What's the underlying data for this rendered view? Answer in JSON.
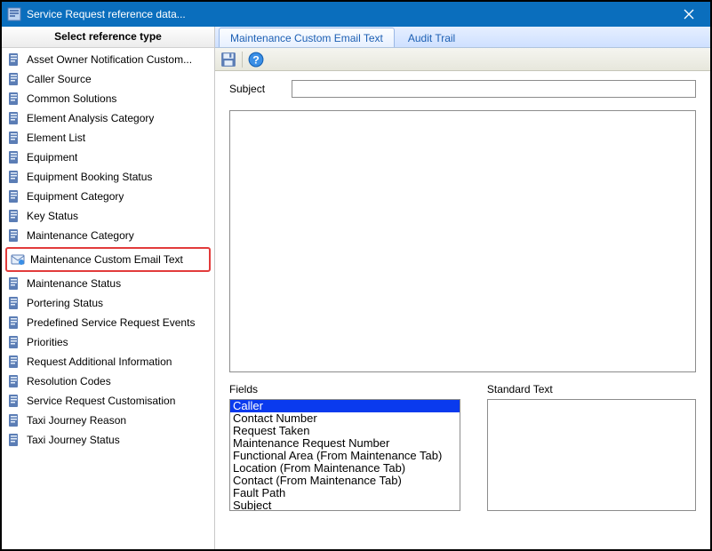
{
  "window": {
    "title": "Service Request reference data..."
  },
  "sidebar": {
    "header": "Select reference type",
    "selected_index": 11,
    "items": [
      "Asset Owner Notification Custom...",
      "Caller Source",
      "Common Solutions",
      "Element Analysis Category",
      "Element List",
      "Equipment",
      "Equipment Booking Status",
      "Equipment Category",
      "Key Status",
      "Maintenance Category",
      "Maintenance Custom Email Text",
      "Maintenance Status",
      "Portering Status",
      "Predefined Service Request Events",
      "Priorities",
      "Request Additional Information",
      "Resolution Codes",
      "Service Request Customisation",
      "Taxi Journey Reason",
      "Taxi Journey Status"
    ]
  },
  "tabs": {
    "active_index": 0,
    "items": [
      "Maintenance Custom Email Text",
      "Audit Trail"
    ]
  },
  "form": {
    "subject_label": "Subject",
    "subject_value": "",
    "body_value": ""
  },
  "fields_panel": {
    "label": "Fields",
    "selected_index": 0,
    "options": [
      "Caller",
      "Contact Number",
      "Request Taken",
      "Maintenance Request Number",
      "Functional Area (From Maintenance Tab)",
      "Location (From Maintenance Tab)",
      "Contact (From Maintenance Tab)",
      "Fault Path",
      "Subject"
    ]
  },
  "standard_text_panel": {
    "label": "Standard Text",
    "value": ""
  }
}
